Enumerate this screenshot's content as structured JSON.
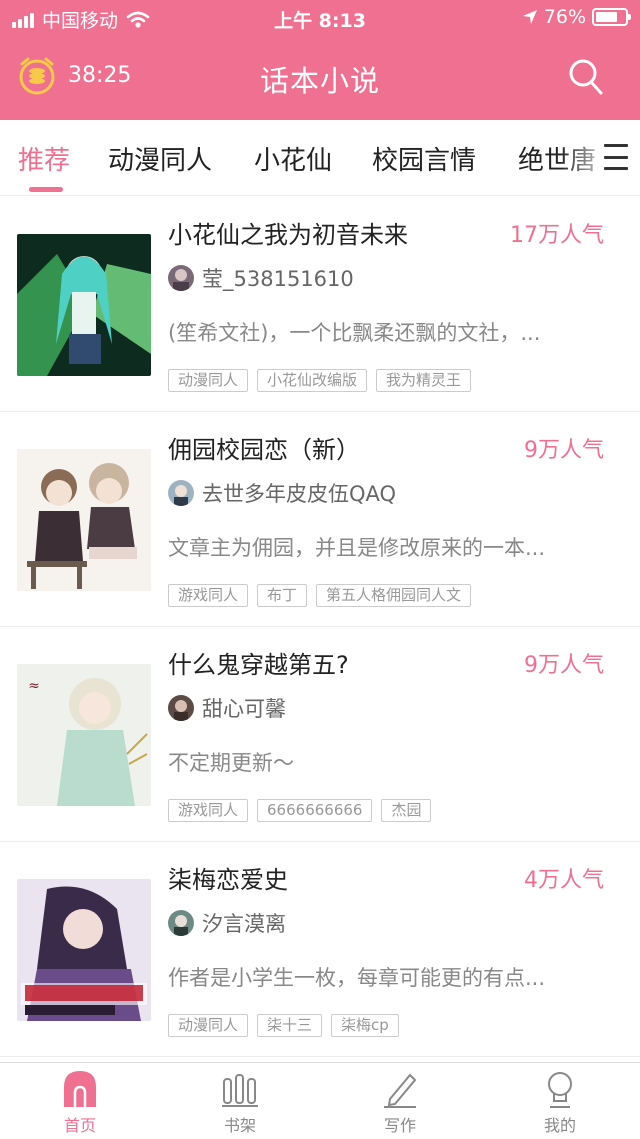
{
  "status_bar": {
    "carrier": "中国移动",
    "time": "上午 8:13",
    "battery": "76%",
    "battery_level": 0.76
  },
  "header": {
    "timer": "38:25",
    "title": "话本小说",
    "search_icon": "search-icon",
    "alarm_icon": "alarm-coin-icon"
  },
  "tabs": [
    {
      "label": "推荐",
      "active": true
    },
    {
      "label": "动漫同人",
      "active": false
    },
    {
      "label": "小花仙",
      "active": false
    },
    {
      "label": "校园言情",
      "active": false
    },
    {
      "label": "绝世唐",
      "active": false
    }
  ],
  "books": [
    {
      "title": "小花仙之我为初音未来",
      "popularity": "17万人气",
      "author": "莹_538151610",
      "description": "(笙希文社)，一个比飘柔还飘的文社，...",
      "tags": [
        "动漫同人",
        "小花仙改编版",
        "我为精灵王"
      ]
    },
    {
      "title": "佣园校园恋（新）",
      "popularity": "9万人气",
      "author": "去世多年皮皮伍QAQ",
      "description": "文章主为佣园，并且是修改原来的一本...",
      "tags": [
        "游戏同人",
        "布丁",
        "第五人格佣园同人文"
      ]
    },
    {
      "title": "什么鬼穿越第五?",
      "popularity": "9万人气",
      "author": "甜心可馨",
      "description": "不定期更新～",
      "tags": [
        "游戏同人",
        "6666666666",
        "杰园"
      ]
    },
    {
      "title": "柒梅恋爱史",
      "popularity": "4万人气",
      "author": "汐言漠离",
      "description": "作者是小学生一枚，每章可能更的有点...",
      "tags": [
        "动漫同人",
        "柒十三",
        "柒梅cp"
      ]
    }
  ],
  "bottom_nav": [
    {
      "label": "首页",
      "icon": "home-icon",
      "active": true
    },
    {
      "label": "书架",
      "icon": "bookshelf-icon",
      "active": false
    },
    {
      "label": "写作",
      "icon": "write-icon",
      "active": false
    },
    {
      "label": "我的",
      "icon": "profile-icon",
      "active": false
    }
  ],
  "colors": {
    "accent": "#ef7090",
    "text": "#222222",
    "muted": "#888888"
  }
}
